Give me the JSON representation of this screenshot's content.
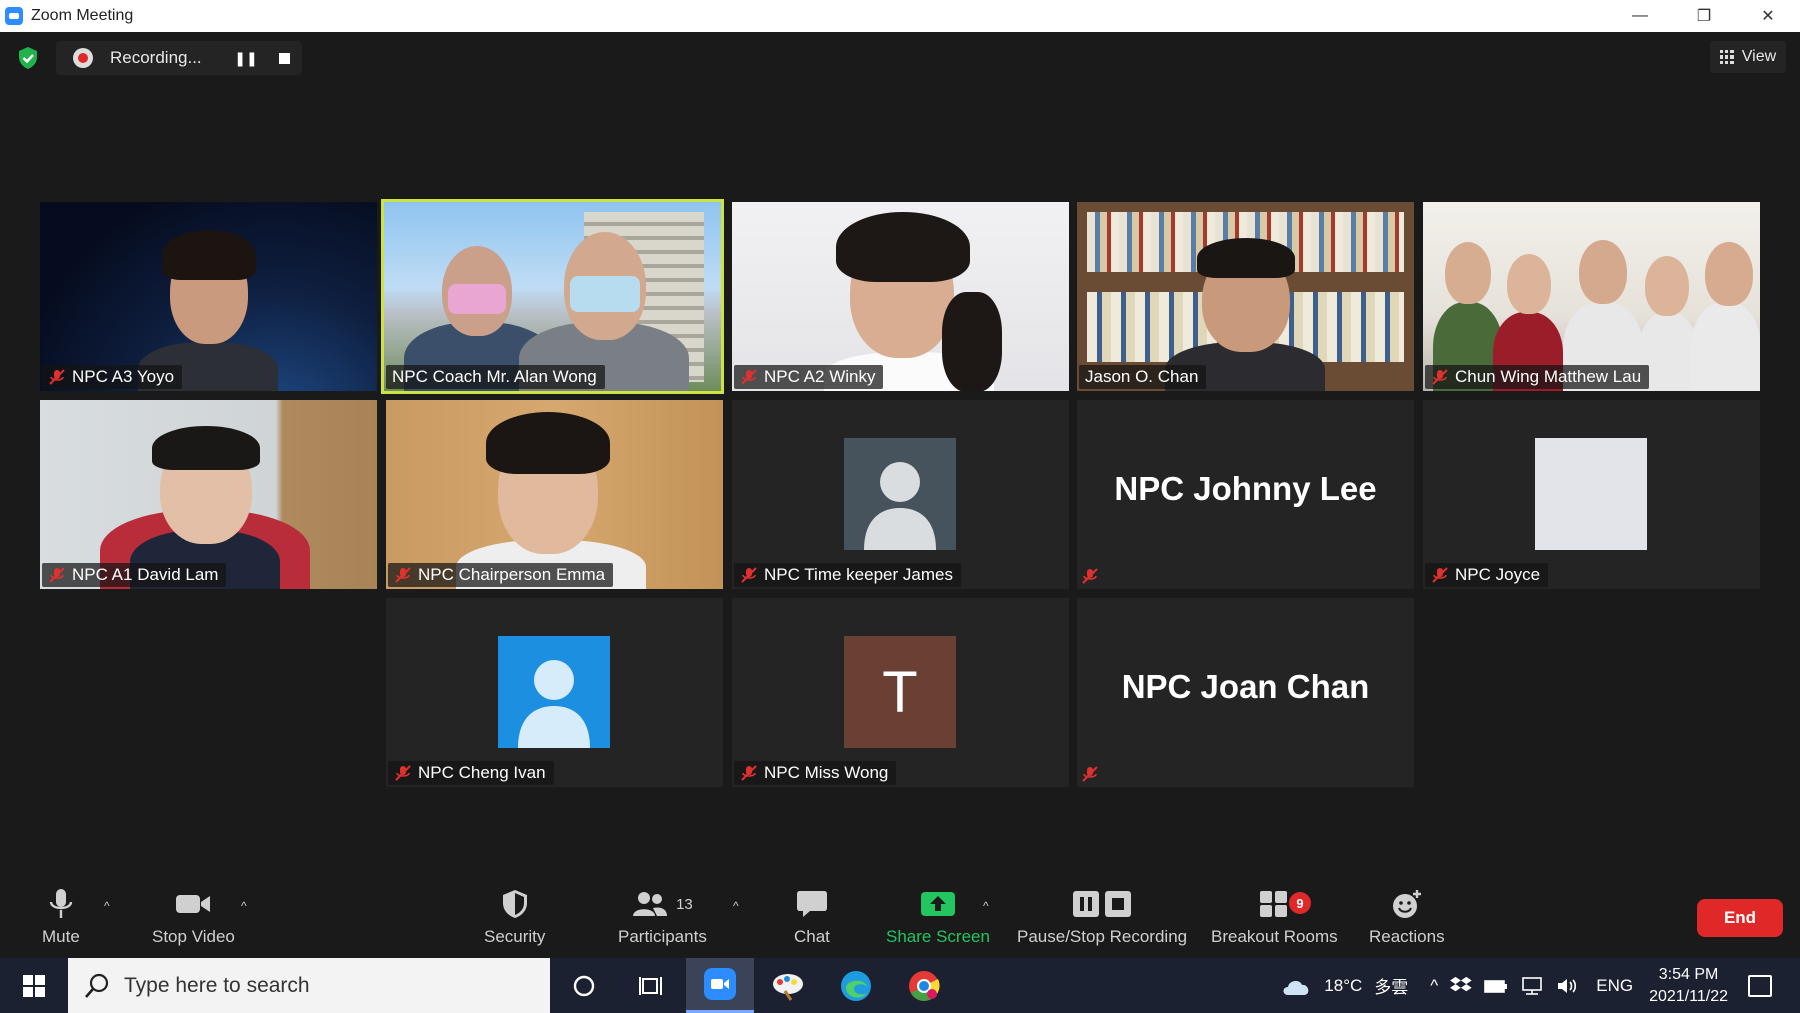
{
  "window": {
    "title": "Zoom Meeting",
    "minimize": "—",
    "restore": "❐",
    "close": "✕"
  },
  "recording": {
    "status": "Recording...",
    "pause_glyph": "❚❚"
  },
  "view_button": {
    "label": "View"
  },
  "participants": {
    "row1": [
      "NPC A3 Yoyo",
      "NPC Coach Mr. Alan Wong",
      "NPC A2 Winky",
      "Jason O. Chan",
      "Chun Wing Matthew Lau"
    ],
    "row2": [
      "NPC A1 David Lam",
      "NPC Chairperson Emma",
      "NPC Time keeper James",
      "NPC Johnny Lee",
      "NPC Joyce"
    ],
    "row3": [
      "NPC Cheng Ivan",
      "NPC Miss Wong",
      "NPC Joan Chan"
    ],
    "miss_wong_initial": "T"
  },
  "toolbar": {
    "mute": "Mute",
    "stop_video": "Stop Video",
    "security": "Security",
    "participants": "Participants",
    "participants_count": "13",
    "chat": "Chat",
    "share_screen": "Share Screen",
    "pause_stop_recording": "Pause/Stop Recording",
    "breakout_rooms": "Breakout Rooms",
    "breakout_badge": "9",
    "reactions": "Reactions",
    "end": "End",
    "caret": "^"
  },
  "taskbar": {
    "search_placeholder": "Type here to search",
    "temperature": "18°C",
    "weather": "多雲",
    "language": "ENG",
    "time": "3:54 PM",
    "date": "2021/11/22"
  },
  "colors": {
    "active_speaker": "#cde341",
    "end_button": "#e02828",
    "share_green": "#22c55e",
    "zoom_blue": "#2d8cff"
  }
}
